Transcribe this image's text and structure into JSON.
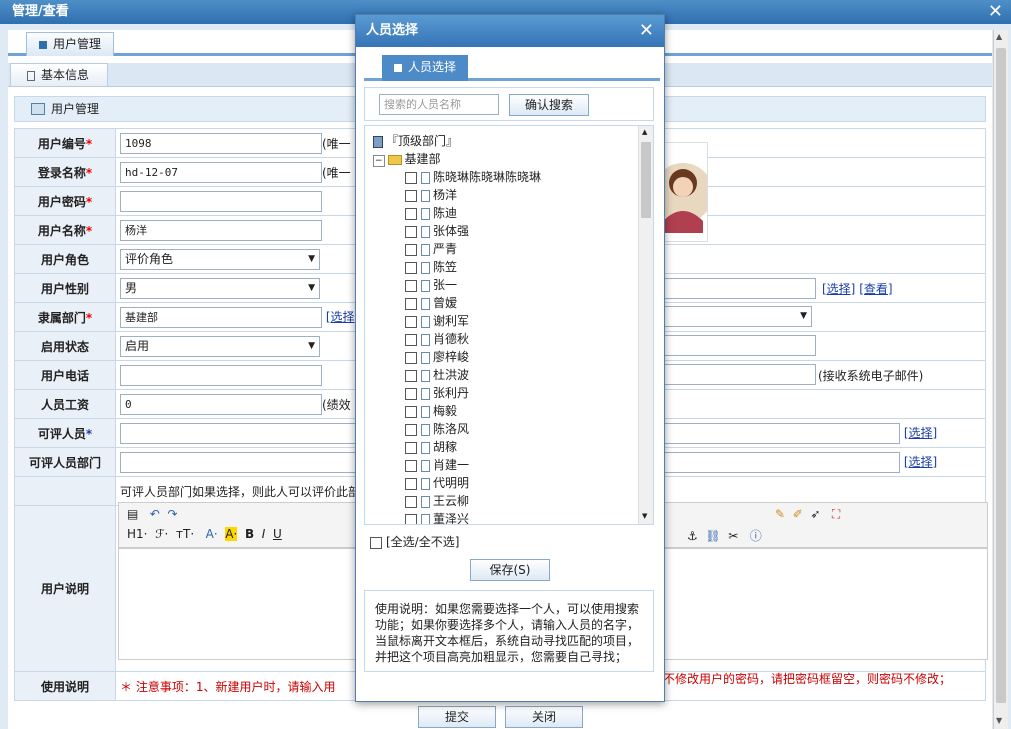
{
  "window": {
    "title": "管理/查看"
  },
  "main_tab": "用户管理",
  "sub_tab": "基本信息",
  "section_title": "用户管理",
  "fields": {
    "user_id": {
      "label": "用户编号",
      "value": "1098",
      "note": "(唯一"
    },
    "login_name": {
      "label": "登录名称",
      "value": "hd-12-07",
      "note": "(唯一"
    },
    "password": {
      "label": "用户密码",
      "value": ""
    },
    "user_name": {
      "label": "用户名称",
      "value": "杨洋"
    },
    "role": {
      "label": "用户角色",
      "value": "评价角色"
    },
    "gender": {
      "label": "用户性别",
      "value": "男"
    },
    "dept": {
      "label": "隶属部门",
      "value": "基建部",
      "action": "[选择"
    },
    "status": {
      "label": "启用状态",
      "value": "启用"
    },
    "phone": {
      "label": "用户电话",
      "value": ""
    },
    "salary": {
      "label": "人员工资",
      "value": "0",
      "note": "(绩效"
    },
    "reviewer": {
      "label": "可评人员",
      "value": "",
      "action": "[选择]"
    },
    "reviewer_dept": {
      "label": "可评人员部门",
      "value": "",
      "action": "[选择]"
    },
    "reviewer_dept_hint": "可评人员部门如果选择，则此人可以评价此部",
    "desc_label": "用户说明",
    "usage_label": "使用说明",
    "usage_text": "＊ 注意事项：1、新建用户时，请输入用",
    "usage_text_right": "不修改用户的密码，请把密码框留空，则密码不修改；"
  },
  "right_col": {
    "select_view": [
      "[选择]",
      "[查看]"
    ],
    "email_note": "(接收系统电子邮件)"
  },
  "editor_toolbar": {
    "heading": "H1·",
    "font": "ℱ·",
    "size": "тT·",
    "bold": "B",
    "italic": "I",
    "underline": "U"
  },
  "buttons": {
    "submit": "提交",
    "close": "关闭"
  },
  "dialog": {
    "title": "人员选择",
    "tab": "人员选择",
    "search_placeholder": "搜索的人员名称",
    "search_button": "确认搜索",
    "root": "『顶级部门』",
    "department": "基建部",
    "people": [
      "陈晓琳陈晓琳陈晓琳",
      "杨洋",
      "陈迪",
      "张体强",
      "严青",
      "陈笠",
      "张一",
      "曾嫒",
      "谢利军",
      "肖德秋",
      "廖梓峻",
      "杜洪波",
      "张利丹",
      "梅毅",
      "陈洛风",
      "胡稼",
      "肖建一",
      "代明明",
      "王云柳",
      "董泽兴"
    ],
    "select_all": "[全选/全不选]",
    "save_button": "保存(S)",
    "help_text": "使用说明：如果您需要选择一个人，可以使用搜索功能；如果你要选择多个人，请输入人员的名字，当鼠标离开文本框后，系统自动寻找匹配的项目，并把这个项目高亮加粗显示，您需要自己寻找；"
  }
}
